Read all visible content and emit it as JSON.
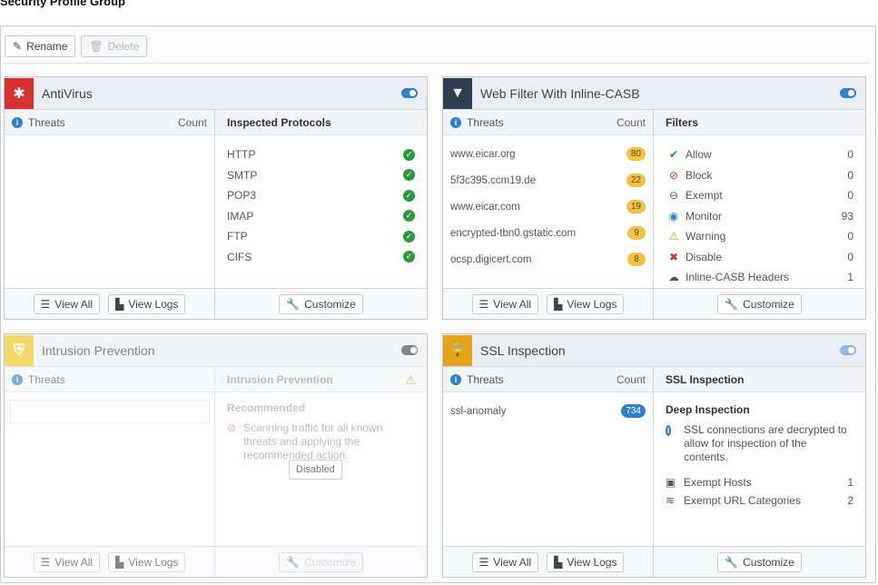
{
  "page": {
    "title": "Security Profile Group"
  },
  "toolbar": {
    "rename_label": "Rename",
    "delete_label": "Delete"
  },
  "footer": {
    "view_all": "View All",
    "view_logs": "View Logs",
    "customize": "Customize"
  },
  "antivirus": {
    "title": "AntiVirus",
    "enabled": true,
    "threats_label": "Threats",
    "count_label": "Count",
    "right_header": "Inspected Protocols",
    "protocols": [
      "HTTP",
      "SMTP",
      "POP3",
      "IMAP",
      "FTP",
      "CIFS"
    ]
  },
  "webfilter": {
    "title": "Web Filter With Inline-CASB",
    "enabled": true,
    "threats_label": "Threats",
    "count_label": "Count",
    "right_header": "Filters",
    "threats": [
      {
        "name": "www.eicar.org",
        "count": "80"
      },
      {
        "name": "5f3c395.ccm19.de",
        "count": "22"
      },
      {
        "name": "www.eicar.com",
        "count": "19"
      },
      {
        "name": "encrypted-tbn0.gstatic.com",
        "count": "9"
      },
      {
        "name": "ocsp.digicert.com",
        "count": "8"
      }
    ],
    "filters": [
      {
        "label": "Allow",
        "value": "0",
        "icon": "check-circle-icon",
        "color": "#2a9a3a"
      },
      {
        "label": "Block",
        "value": "0",
        "icon": "block-icon",
        "color": "#d33"
      },
      {
        "label": "Exempt",
        "value": "0",
        "icon": "exempt-icon",
        "color": "#555"
      },
      {
        "label": "Monitor",
        "value": "93",
        "icon": "eye-icon",
        "color": "#2f7fd3"
      },
      {
        "label": "Warning",
        "value": "0",
        "icon": "warning-icon",
        "color": "#e08a1e"
      },
      {
        "label": "Disable",
        "value": "0",
        "icon": "disable-icon",
        "color": "#d33"
      },
      {
        "label": "Inline-CASB Headers",
        "value": "1",
        "icon": "cloud-icon",
        "color": "#555"
      }
    ]
  },
  "ips": {
    "title": "Intrusion Prevention",
    "enabled": false,
    "threats_label": "Threats",
    "right_header": "Intrusion Prevention",
    "recommended": "Recommended",
    "description": "Scanning traffic for all known threats and applying the recommended action.",
    "tooltip": "Disabled"
  },
  "ssl": {
    "title": "SSL Inspection",
    "enabled": true,
    "threats_label": "Threats",
    "count_label": "Count",
    "right_header": "SSL Inspection",
    "threat_name": "ssl-anomaly",
    "threat_count": "734",
    "mode": "Deep Inspection",
    "description": "SSL connections are decrypted to allow for inspection of the contents.",
    "exempt_hosts_label": "Exempt Hosts",
    "exempt_hosts_value": "1",
    "exempt_url_label": "Exempt URL Categories",
    "exempt_url_value": "2"
  },
  "colors": {
    "antivirus_icon": "#d9322e",
    "webfilter_icon": "#2d3e50",
    "ips_icon": "#f0c419",
    "ssl_icon": "#e7a51b",
    "accent": "#2f7fd3"
  }
}
